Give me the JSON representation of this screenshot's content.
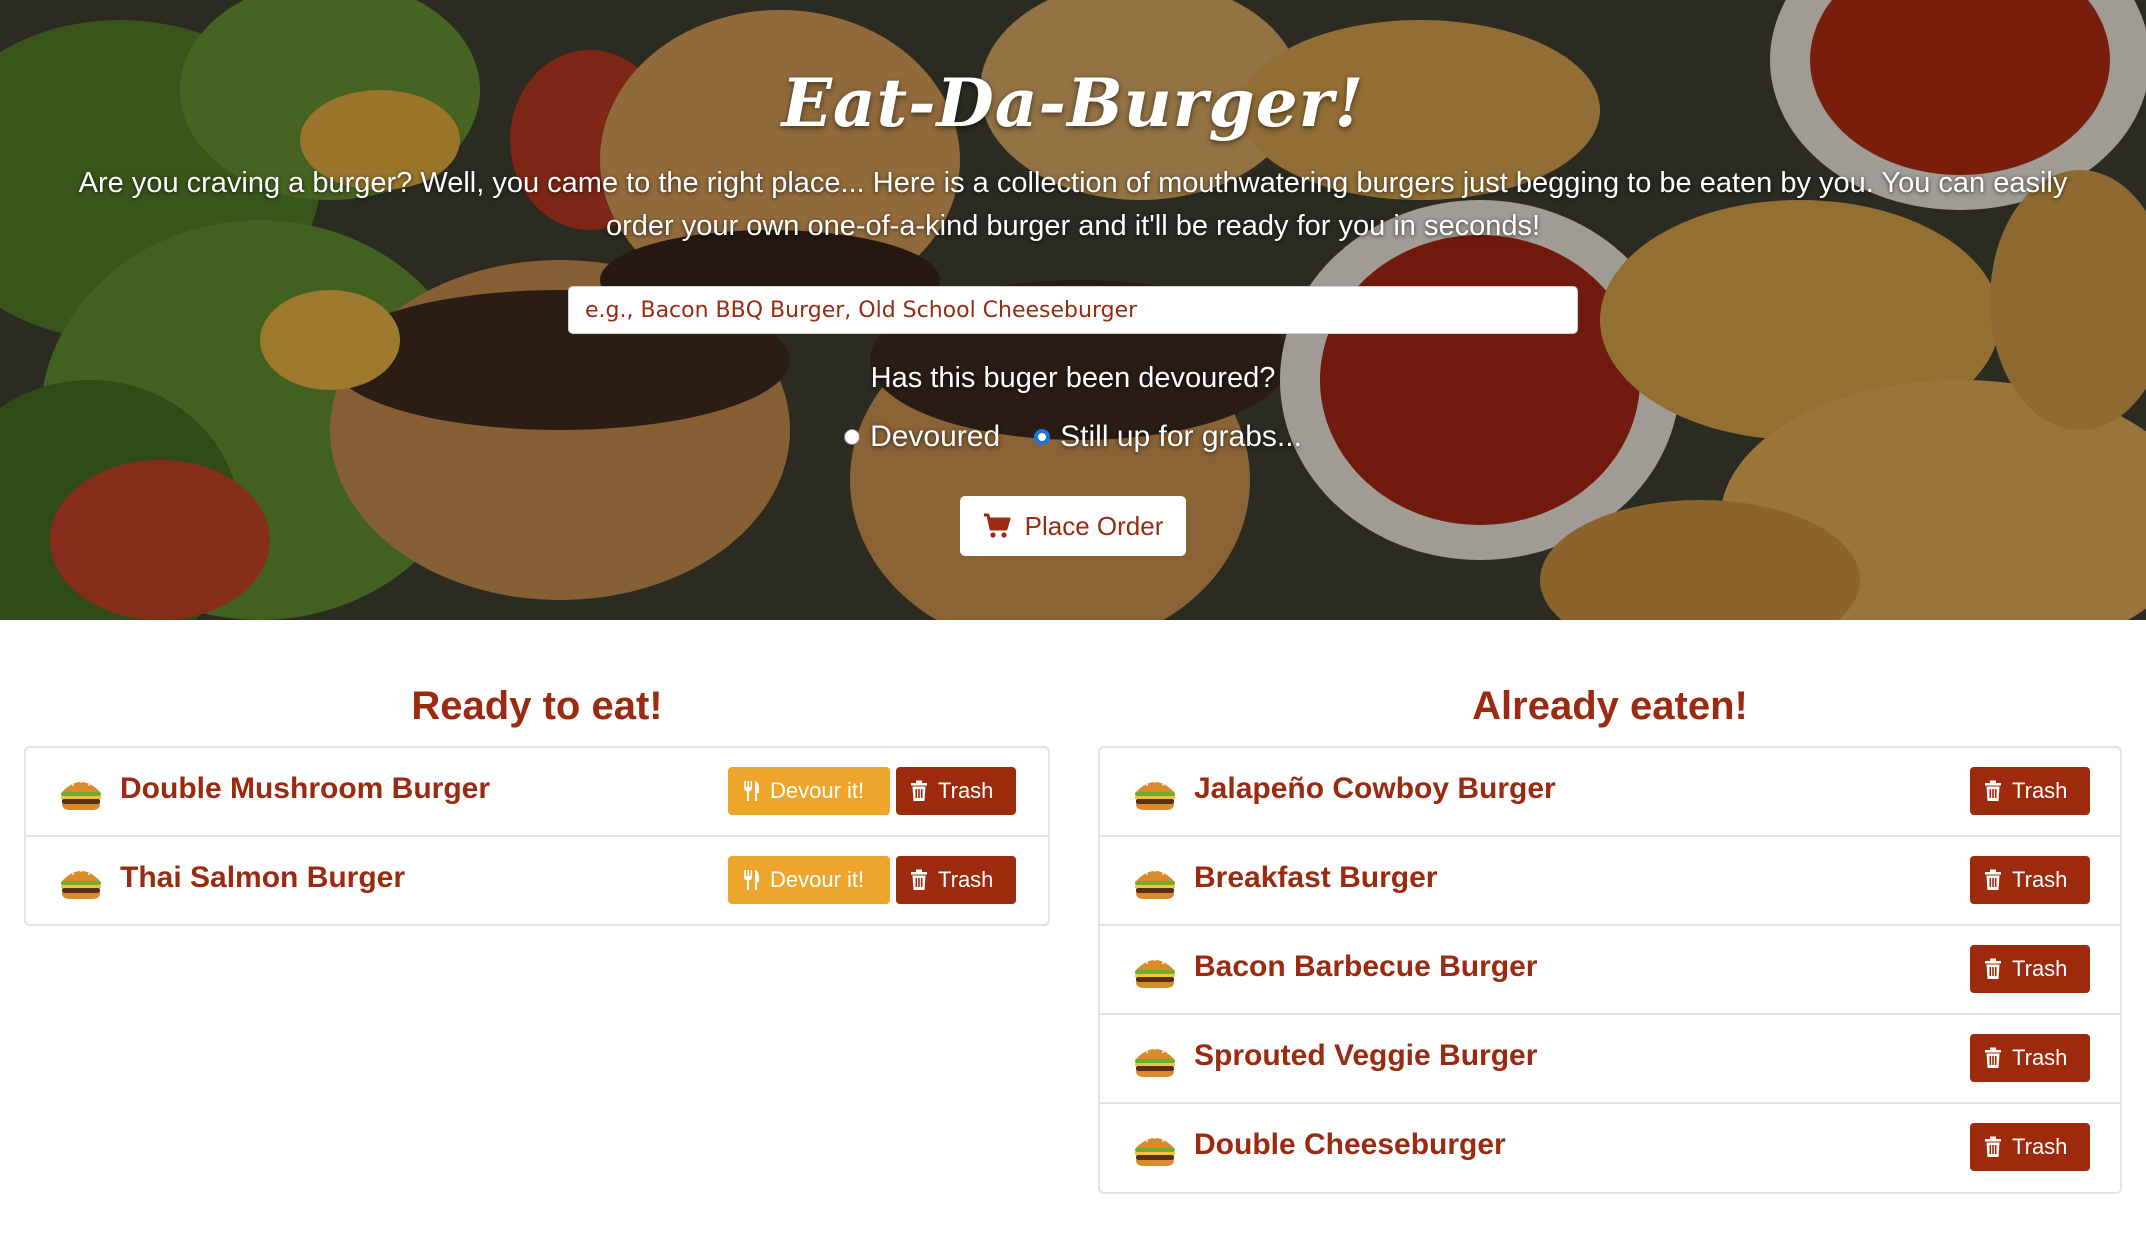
{
  "hero": {
    "title": "Eat-Da-Burger!",
    "description": "Are you craving a burger? Well, you came to the right place... Here is a collection of mouthwatering burgers just begging to be eaten by you. You can easily order your own one-of-a-kind burger and it'll be ready for you in seconds!",
    "input_placeholder": "e.g., Bacon BBQ Burger, Old School Cheeseburger",
    "input_value": "",
    "devoured_question": "Has this buger been devoured?",
    "radio_devoured": "Devoured",
    "radio_available": "Still up for grabs...",
    "selected_radio": "Still up for grabs...",
    "place_order_label": "Place Order",
    "place_order_icon": "shopping-cart-icon"
  },
  "ready": {
    "heading": "Ready to eat!",
    "items": [
      {
        "name": "Double Mushroom Burger",
        "devour_label": "Devour it!",
        "trash_label": "Trash"
      },
      {
        "name": "Thai Salmon Burger",
        "devour_label": "Devour it!",
        "trash_label": "Trash"
      }
    ]
  },
  "eaten": {
    "heading": "Already eaten!",
    "items": [
      {
        "name": "Jalapeño Cowboy Burger",
        "trash_label": "Trash"
      },
      {
        "name": "Breakfast Burger",
        "trash_label": "Trash"
      },
      {
        "name": "Bacon Barbecue Burger",
        "trash_label": "Trash"
      },
      {
        "name": "Sprouted Veggie Burger",
        "trash_label": "Trash"
      },
      {
        "name": "Double Cheeseburger",
        "trash_label": "Trash"
      }
    ]
  },
  "icons": {
    "burger": "burger-icon",
    "devour": "utensils-icon",
    "trash": "trash-icon"
  },
  "colors": {
    "accent": "#9a2b10",
    "devour_button": "#eda52b",
    "trash_button": "#9e2a0d",
    "radio_selected": "#1a73e8"
  }
}
